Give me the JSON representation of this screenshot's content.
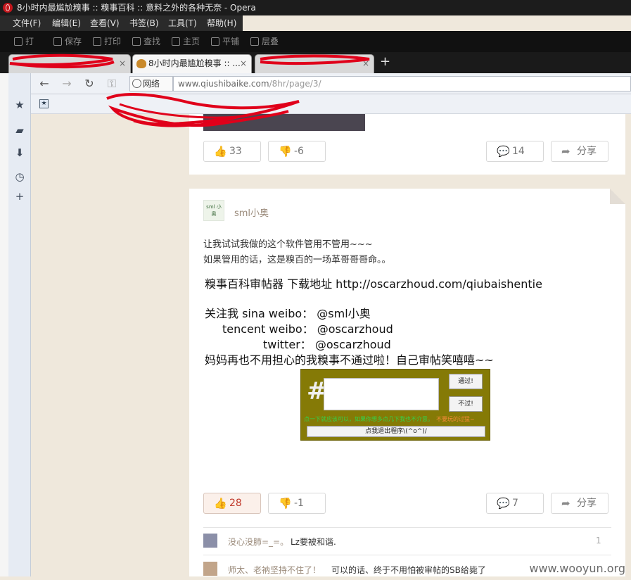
{
  "window": {
    "title": "8小时内最尴尬糗事 :: 糗事百科 :: 意料之外的各种无奈 - Opera"
  },
  "menubar": [
    "文件(F)",
    "编辑(E)",
    "查看(V)",
    "书签(B)",
    "工具(T)",
    "帮助(H)"
  ],
  "toolbar": [
    "打",
    "保存",
    "打印",
    "查找",
    "主页",
    "平铺",
    "层叠"
  ],
  "tabs": [
    {
      "label": "",
      "close": "×"
    },
    {
      "label": "8小时内最尴尬糗事 :: ...",
      "close": "×"
    },
    {
      "label": "",
      "close": "×"
    }
  ],
  "new_tab": "+",
  "address": {
    "prefix_label": "网络",
    "domain": "www.qiushibaike.com",
    "path": "/8hr/page/3/"
  },
  "post1": {
    "up_count": "33",
    "down_count": "-6",
    "comment_count": "14",
    "share_label": "分享"
  },
  "post2": {
    "avatar_text": "sml 小奥",
    "username": "sml小奥",
    "lines": [
      "让我试试我做的这个软件管用不管用~~~",
      "如果管用的话，这是糗百的一场革哥哥哥命。。"
    ],
    "big_lines": [
      "糗事百科审帖器 下载地址 http://oscarzhoud.com/qiubaishentie",
      "关注我 sina weibo： @sml小奥",
      "tencent weibo： @oscarzhoud",
      "twitter： @oscarzhoud",
      "妈妈再也不用担心的我糗事不通过啦！自己审帖笑嘻嘻~~"
    ],
    "app": {
      "hash": "#",
      "pass_label": "通过!",
      "fail_label": "不过!",
      "hint_green": "点一下就应该可以，如果你想多点几下我也不介意。",
      "hint_orange": "不要玩的过猛~",
      "exit_label": "点我退出程序\\(^o^)/"
    },
    "up_count": "28",
    "down_count": "-1",
    "comment_count": "7",
    "share_label": "分享"
  },
  "comments": [
    {
      "name": "没心没肺=_=。",
      "text": "Lz要被和谐.",
      "index": "1"
    },
    {
      "name": "师太、老衲坚持不住了！",
      "text": "可以的话、终于不用怕被审帖的SB给毙了",
      "index": ""
    }
  ],
  "watermark": "www.wooyun.org",
  "colors": {
    "page_bg": "#efe8dc",
    "app_bg": "#857a06",
    "scribble": "#e0001a",
    "liked_up": "#c0392b"
  }
}
